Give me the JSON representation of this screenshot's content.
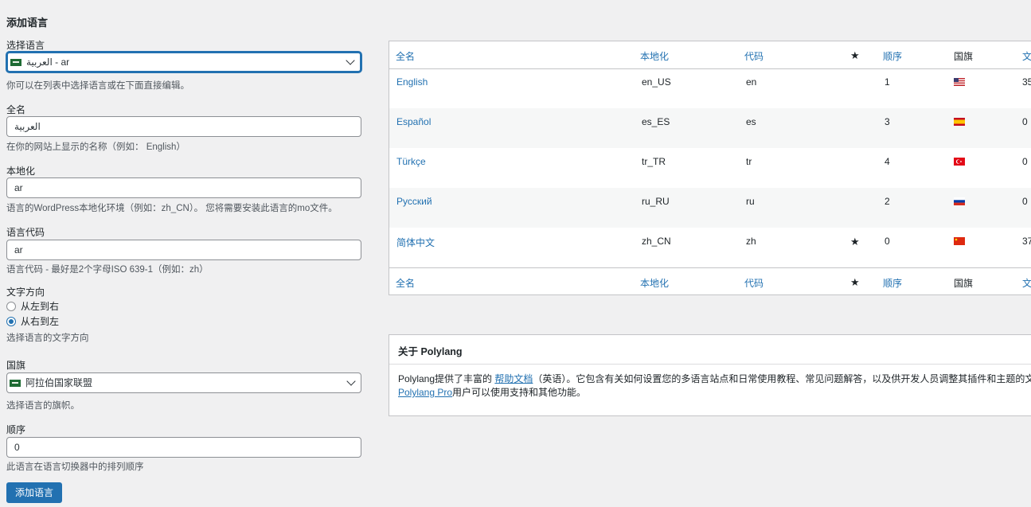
{
  "form": {
    "title": "添加语言",
    "language_select": {
      "label": "选择语言",
      "value": "العربية - ar",
      "help": "你可以在列表中选择语言或在下面直接编辑。"
    },
    "full_name": {
      "label": "全名",
      "value": "العربية",
      "help": "在你的网站上显示的名称（例如： English）"
    },
    "locale": {
      "label": "本地化",
      "value": "ar",
      "help": "语言的WordPress本地化环境（例如：zh_CN）。 您将需要安装此语言的mo文件。"
    },
    "code": {
      "label": "语言代码",
      "value": "ar",
      "help": "语言代码 - 最好是2个字母ISO 639-1（例如：zh）"
    },
    "direction": {
      "label": "文字方向",
      "options": [
        "从左到右",
        "从右到左"
      ],
      "selected": "从右到左",
      "help": "选择语言的文字方向"
    },
    "flag": {
      "label": "国旗",
      "value": "阿拉伯国家联盟",
      "help": "选择语言的旗帜。"
    },
    "order": {
      "label": "顺序",
      "value": "0",
      "help": "此语言在语言切换器中的排列顺序"
    },
    "submit_label": "添加语言"
  },
  "table": {
    "headers": {
      "name": "全名",
      "locale": "本地化",
      "code": "代码",
      "default": "★",
      "order": "顺序",
      "flag": "国旗",
      "posts": "文"
    },
    "rows": [
      {
        "name": "English",
        "locale": "en_US",
        "code": "en",
        "default": "",
        "order": "1",
        "flag_icon": "flag-us-icon",
        "posts": "35"
      },
      {
        "name": "Español",
        "locale": "es_ES",
        "code": "es",
        "default": "",
        "order": "3",
        "flag_icon": "flag-es-icon",
        "posts": "0"
      },
      {
        "name": "Türkçe",
        "locale": "tr_TR",
        "code": "tr",
        "default": "",
        "order": "4",
        "flag_icon": "flag-tr-icon",
        "posts": "0"
      },
      {
        "name": "Русский",
        "locale": "ru_RU",
        "code": "ru",
        "default": "",
        "order": "2",
        "flag_icon": "flag-ru-icon",
        "posts": "0"
      },
      {
        "name": "简体中文",
        "locale": "zh_CN",
        "code": "zh",
        "default": "★",
        "order": "0",
        "flag_icon": "flag-cn-icon",
        "posts": "37"
      }
    ]
  },
  "about": {
    "title": "关于 Polylang",
    "text_1": "Polylang提供了丰富的 ",
    "link_docs": "帮助文档",
    "text_2": "（英语）。它包含有关如何设置您的多语言站点和日常使用教程、常见问题解答，以及供开发人员调整其插件和主题的文",
    "link_pro": "Polylang Pro",
    "text_3": "用户可以使用支持和其他功能。"
  },
  "colors": {
    "accent": "#2271b1",
    "background": "#f0f0f1",
    "text": "#1d2327"
  }
}
